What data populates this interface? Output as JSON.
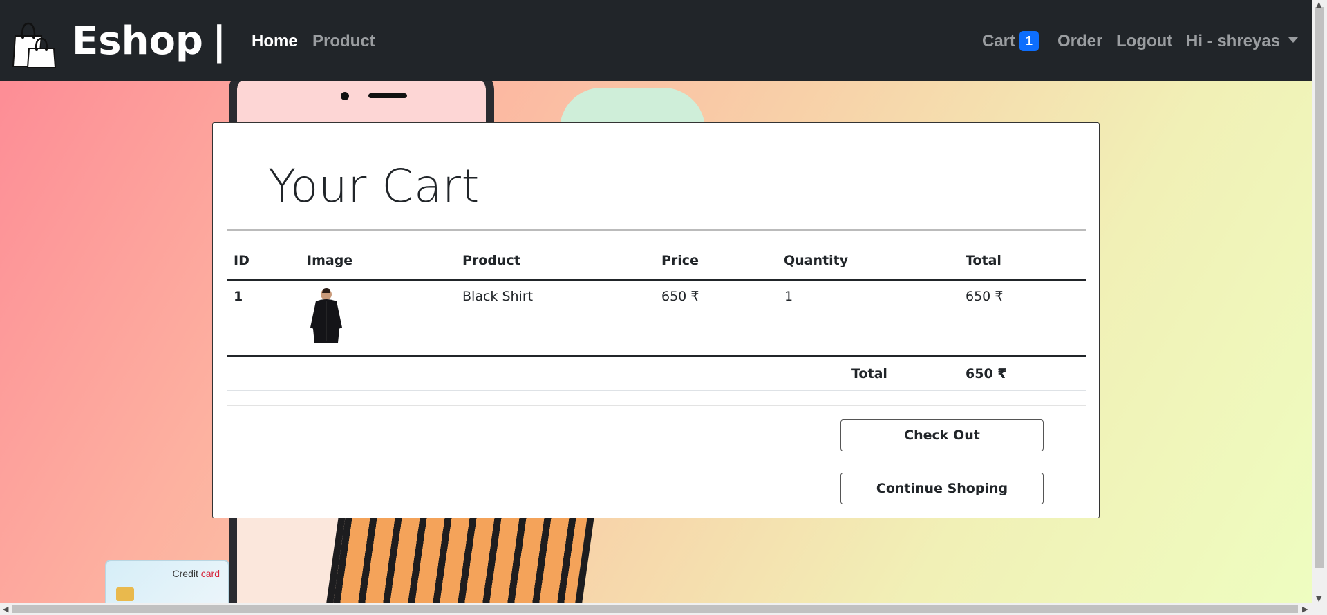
{
  "navbar": {
    "brand": "Eshop",
    "separator": "|",
    "links": {
      "home": "Home",
      "product": "Product",
      "cart": "Cart",
      "order": "Order",
      "logout": "Logout",
      "user": "Hi - shreyas"
    },
    "cart_count": "1"
  },
  "cart": {
    "title": "Your Cart",
    "headers": [
      "ID",
      "Image",
      "Product",
      "Price",
      "Quantity",
      "Total"
    ],
    "rows": [
      {
        "id": "1",
        "image": "black-shirt-image",
        "product": "Black Shirt",
        "price": "650 ₹",
        "quantity": "1",
        "total": "650 ₹"
      }
    ],
    "footer": {
      "label": "Total",
      "value": "650 ₹"
    },
    "buttons": {
      "checkout": "Check Out",
      "continue": "Continue Shoping"
    }
  },
  "background": {
    "card_label_1": "Credit",
    "card_label_2": "card"
  },
  "colors": {
    "navbar": "#212529",
    "badge": "#0d6efd"
  }
}
